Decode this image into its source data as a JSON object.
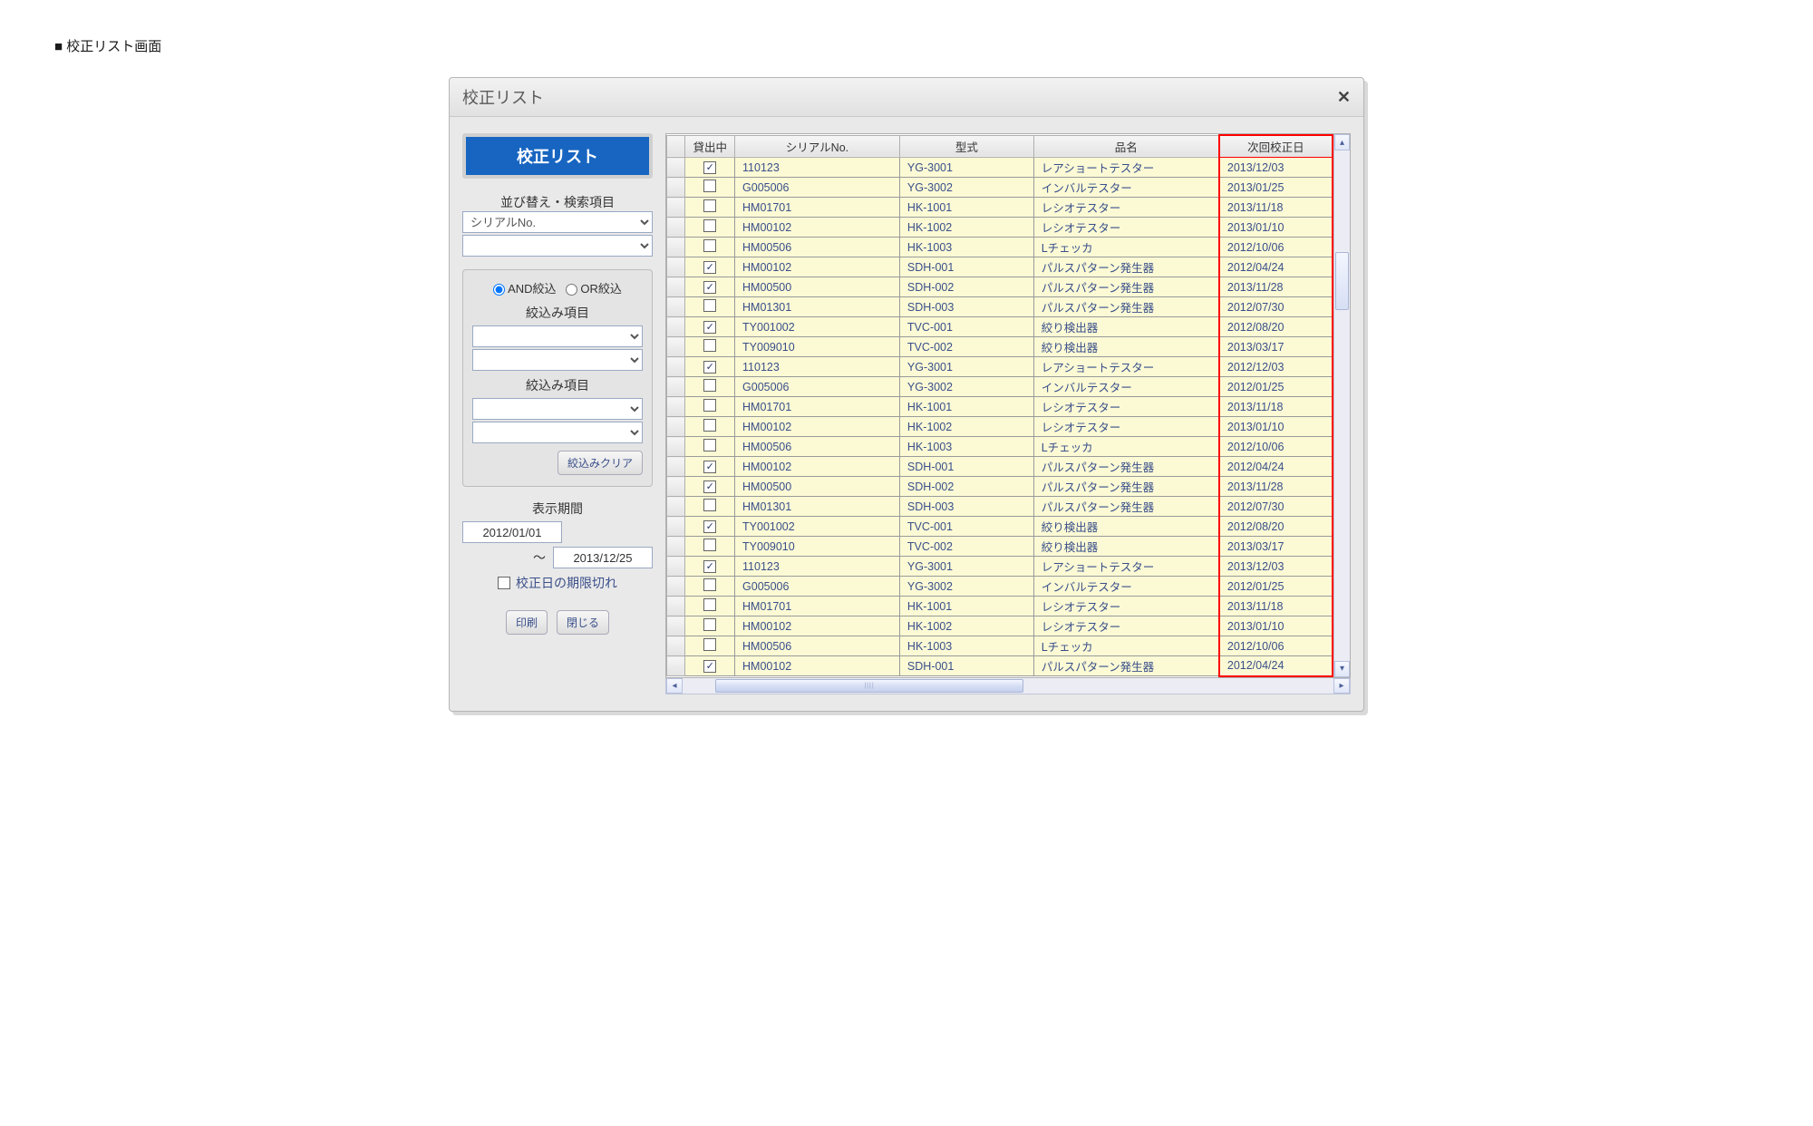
{
  "page_caption": "■ 校正リスト画面",
  "window": {
    "title": "校正リスト"
  },
  "main_button": "校正リスト",
  "sort_section": {
    "label": "並び替え・検索項目",
    "select1": "シリアルNo.",
    "select2": ""
  },
  "filter_panel": {
    "radio_and": "AND絞込",
    "radio_or": "OR絞込",
    "group_label1": "絞込み項目",
    "group_label2": "絞込み項目",
    "clear_btn": "絞込みクリア"
  },
  "period": {
    "label": "表示期間",
    "from": "2012/01/01",
    "tilde": "～",
    "to": "2013/12/25",
    "expired_label": "校正日の期限切れ"
  },
  "bottom_buttons": {
    "print": "印刷",
    "close": "閉じる"
  },
  "table": {
    "headers": {
      "handle": "",
      "rented": "貸出中",
      "serial": "シリアルNo.",
      "model": "型式",
      "name": "品名",
      "next_cal": "次回校正日"
    },
    "rows": [
      {
        "cb": true,
        "serial": "110123",
        "model": "YG-3001",
        "name": "レアショートテスター",
        "date": "2013/12/03"
      },
      {
        "cb": false,
        "serial": "G005006",
        "model": "YG-3002",
        "name": "インバルテスター",
        "date": "2013/01/25"
      },
      {
        "cb": false,
        "serial": "HM01701",
        "model": "HK-1001",
        "name": "レシオテスター",
        "date": "2013/11/18"
      },
      {
        "cb": false,
        "serial": "HM00102",
        "model": "HK-1002",
        "name": "レシオテスター",
        "date": "2013/01/10"
      },
      {
        "cb": false,
        "serial": "HM00506",
        "model": "HK-1003",
        "name": "Lチェッカ",
        "date": "2012/10/06"
      },
      {
        "cb": true,
        "serial": "HM00102",
        "model": "SDH-001",
        "name": "パルスパターン発生器",
        "date": "2012/04/24"
      },
      {
        "cb": true,
        "serial": "HM00500",
        "model": "SDH-002",
        "name": "パルスパターン発生器",
        "date": "2013/11/28"
      },
      {
        "cb": false,
        "serial": "HM01301",
        "model": "SDH-003",
        "name": "パルスパターン発生器",
        "date": "2012/07/30"
      },
      {
        "cb": true,
        "serial": "TY001002",
        "model": "TVC-001",
        "name": "絞り検出器",
        "date": "2012/08/20"
      },
      {
        "cb": false,
        "serial": "TY009010",
        "model": "TVC-002",
        "name": "絞り検出器",
        "date": "2013/03/17"
      },
      {
        "cb": true,
        "serial": "110123",
        "model": "YG-3001",
        "name": "レアショートテスター",
        "date": "2012/12/03"
      },
      {
        "cb": false,
        "serial": "G005006",
        "model": "YG-3002",
        "name": "インバルテスター",
        "date": "2012/01/25"
      },
      {
        "cb": false,
        "serial": "HM01701",
        "model": "HK-1001",
        "name": "レシオテスター",
        "date": "2013/11/18"
      },
      {
        "cb": false,
        "serial": "HM00102",
        "model": "HK-1002",
        "name": "レシオテスター",
        "date": "2013/01/10"
      },
      {
        "cb": false,
        "serial": "HM00506",
        "model": "HK-1003",
        "name": "Lチェッカ",
        "date": "2012/10/06"
      },
      {
        "cb": true,
        "serial": "HM00102",
        "model": "SDH-001",
        "name": "パルスパターン発生器",
        "date": "2012/04/24"
      },
      {
        "cb": true,
        "serial": "HM00500",
        "model": "SDH-002",
        "name": "パルスパターン発生器",
        "date": "2013/11/28"
      },
      {
        "cb": false,
        "serial": "HM01301",
        "model": "SDH-003",
        "name": "パルスパターン発生器",
        "date": "2012/07/30"
      },
      {
        "cb": true,
        "serial": "TY001002",
        "model": "TVC-001",
        "name": "絞り検出器",
        "date": "2012/08/20"
      },
      {
        "cb": false,
        "serial": "TY009010",
        "model": "TVC-002",
        "name": "絞り検出器",
        "date": "2013/03/17"
      },
      {
        "cb": true,
        "serial": "110123",
        "model": "YG-3001",
        "name": "レアショートテスター",
        "date": "2013/12/03"
      },
      {
        "cb": false,
        "serial": "G005006",
        "model": "YG-3002",
        "name": "インバルテスター",
        "date": "2012/01/25"
      },
      {
        "cb": false,
        "serial": "HM01701",
        "model": "HK-1001",
        "name": "レシオテスター",
        "date": "2013/11/18"
      },
      {
        "cb": false,
        "serial": "HM00102",
        "model": "HK-1002",
        "name": "レシオテスター",
        "date": "2013/01/10"
      },
      {
        "cb": false,
        "serial": "HM00506",
        "model": "HK-1003",
        "name": "Lチェッカ",
        "date": "2012/10/06"
      },
      {
        "cb": true,
        "serial": "HM00102",
        "model": "SDH-001",
        "name": "パルスパターン発生器",
        "date": "2012/04/24"
      }
    ]
  }
}
